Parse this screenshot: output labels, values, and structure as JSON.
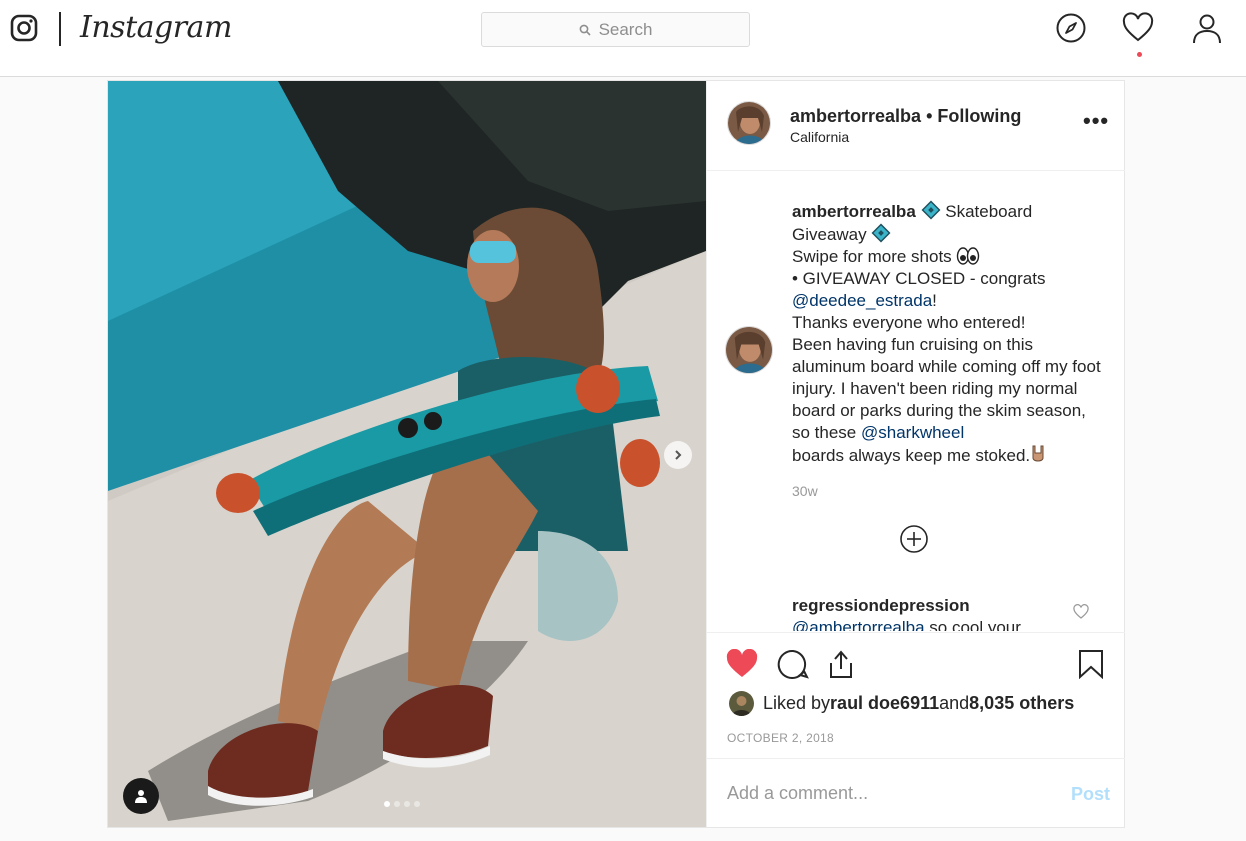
{
  "nav": {
    "brand": "Instagram",
    "search_placeholder": "Search",
    "icons": [
      "instagram-glyph-icon",
      "search-icon",
      "explore-compass-icon",
      "activity-heart-icon",
      "profile-icon"
    ]
  },
  "post": {
    "username": "ambertorrealba",
    "separator": " • ",
    "follow_status": "Following",
    "location": "California",
    "more": "•••",
    "carousel": {
      "current": 1,
      "total": 4
    },
    "caption": {
      "username": "ambertorrealba",
      "title_start": " Skateboard",
      "title_end": "Giveaway",
      "line_swipe": "Swipe for more shots",
      "line_closed": "• GIVEAWAY CLOSED - congrats",
      "mention_winner": "@deedee_estrada",
      "exclaim": "!",
      "line_thanks": "Thanks everyone who entered!",
      "body_1": "Been having fun cruising on this aluminum board while coming off my foot injury. I haven't been riding my normal board or parks during the skim season, so these ",
      "mention_brand": "@sharkwheel",
      "body_2": "boards always keep me stoked."
    },
    "age": "30w",
    "comment": {
      "username": "regressiondepression",
      "mention": "@ambertorrealba",
      "text": " so cool your"
    },
    "liked_by_prefix": "Liked by ",
    "liked_by_user": "raul doe6911",
    "liked_by_and": " and ",
    "liked_by_count": "8,035 others",
    "date": "OCTOBER 2, 2018",
    "add_comment_placeholder": "Add a comment...",
    "post_label": "Post"
  },
  "colors": {
    "like_red": "#ed4956",
    "link_blue": "#003569",
    "post_disabled": "#b2dffc",
    "border": "#dbdbdb"
  }
}
